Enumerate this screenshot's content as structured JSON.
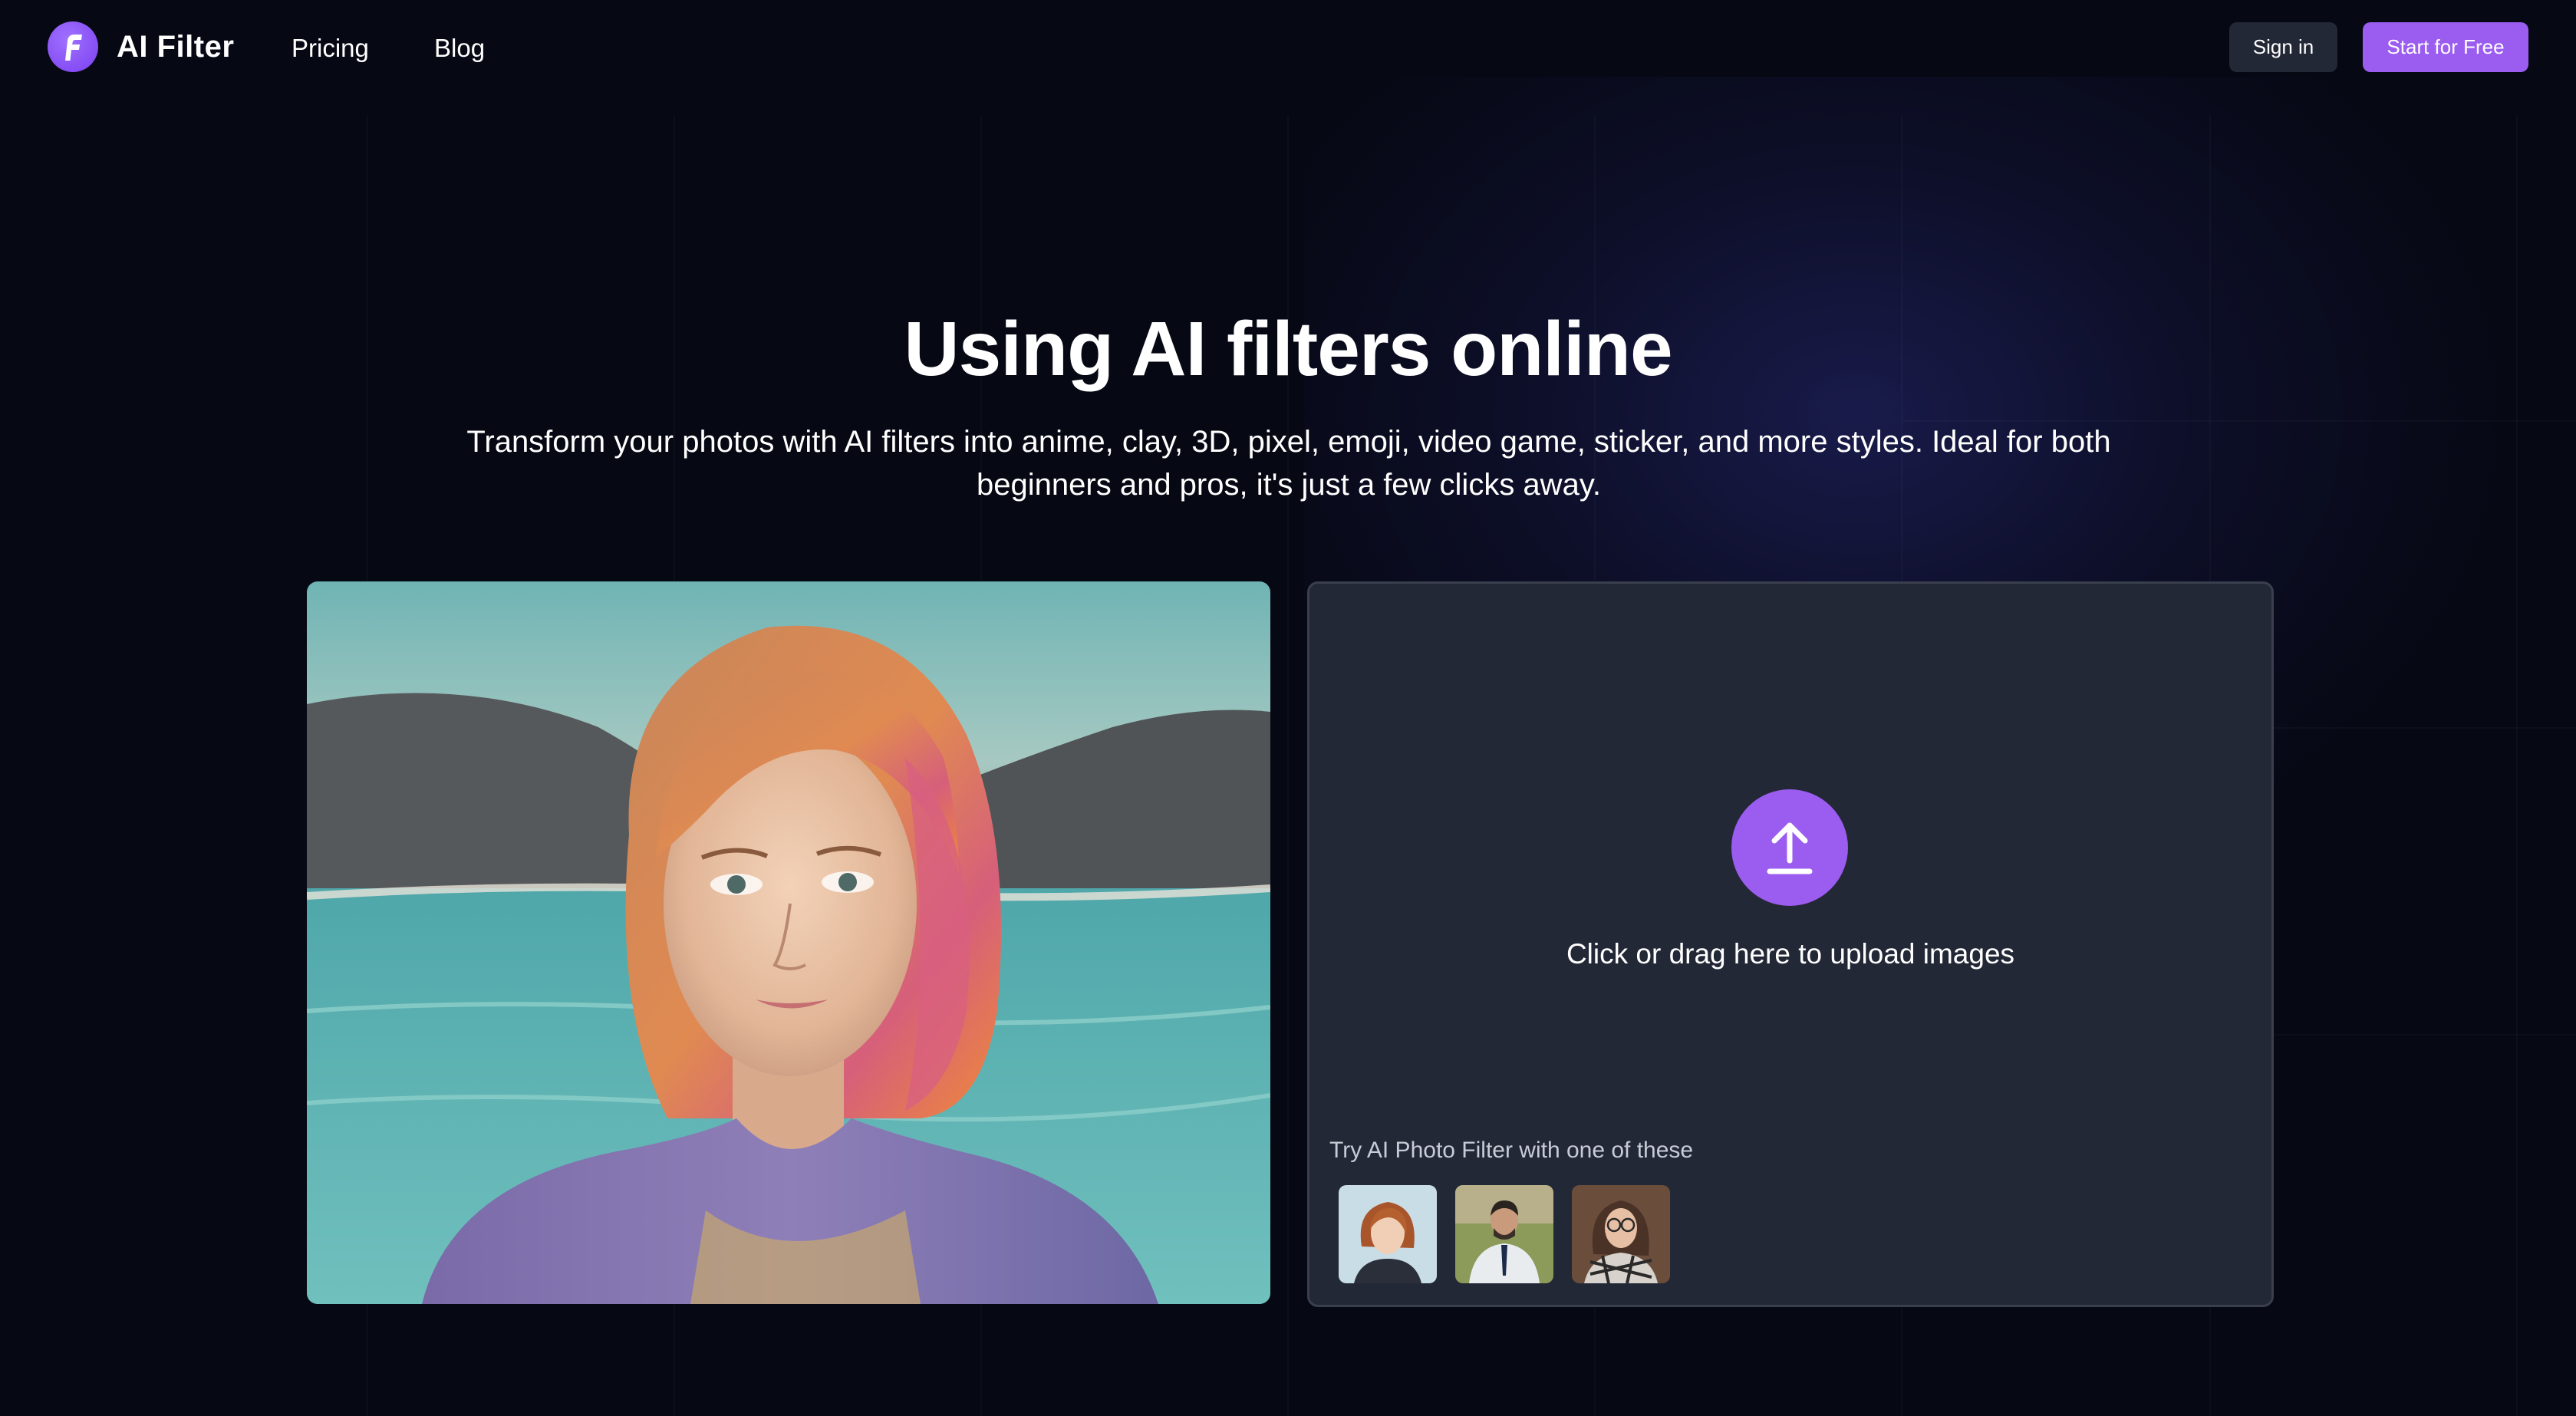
{
  "brand": {
    "name": "AI Filter",
    "logo_letter": "F",
    "accent": "#9b5cf0"
  },
  "nav": {
    "items": [
      "Pricing",
      "Blog"
    ]
  },
  "auth": {
    "sign_in": "Sign in",
    "start": "Start for Free"
  },
  "hero": {
    "title": "Using AI filters online",
    "subtitle_line1": "Transform your photos with AI filters into anime, clay, 3D, pixel, emoji, video game, sticker, and more styles. Ideal for both",
    "subtitle_line2": "beginners and pros, it's just a few clicks away."
  },
  "upload": {
    "label": "Click or drag here to upload images",
    "icon": "upload-icon",
    "try_label": "Try AI Photo Filter with one of these"
  },
  "samples": [
    {
      "name": "sample-woman-redhead"
    },
    {
      "name": "sample-man-suit"
    },
    {
      "name": "sample-woman-glasses"
    }
  ]
}
